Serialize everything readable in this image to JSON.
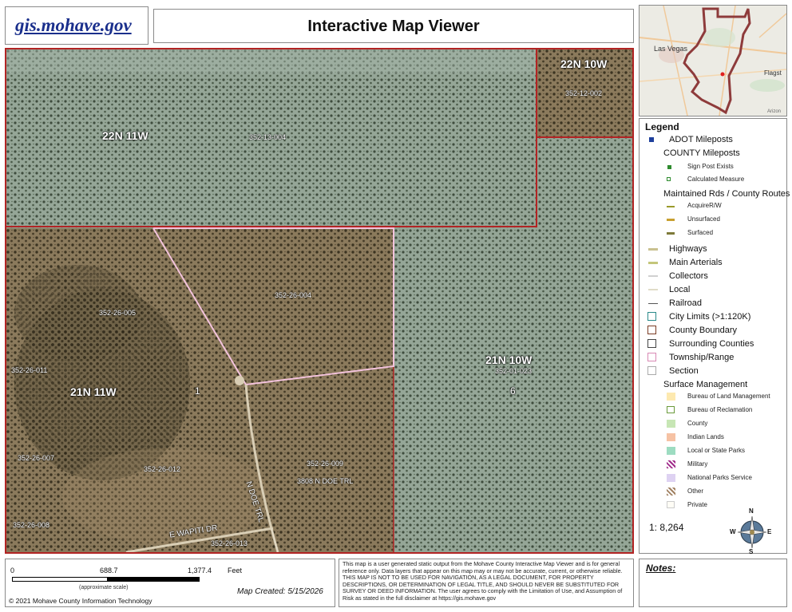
{
  "header": {
    "logo_text": "gis.mohave.gov",
    "title": "Interactive Map Viewer"
  },
  "map": {
    "township_labels": [
      "22N 11W",
      "22N 10W",
      "21N 11W",
      "21N 10W"
    ],
    "section_numbers": [
      "1",
      "6"
    ],
    "parcels": [
      "352-13-004",
      "352-12-002",
      "352-26-005",
      "352-26-004",
      "352-26-011",
      "352-01-023",
      "352-26-007",
      "352-26-012",
      "352-26-009",
      "352-26-008",
      "352-26-013"
    ],
    "address": "3808 N DOE TRL",
    "roads": [
      "E WAPITI DR",
      "N DOE TRL"
    ]
  },
  "inset": {
    "places": [
      "Las Vegas",
      "Flagst",
      "Arizon"
    ]
  },
  "legend": {
    "title": "Legend",
    "items": [
      {
        "label": "ADOT Mileposts",
        "size": "big",
        "symbol": "square-blue"
      },
      {
        "label": "COUNTY Mileposts",
        "size": "head"
      },
      {
        "label": "Sign Post Exists",
        "size": "small",
        "symbol": "square-green"
      },
      {
        "label": "Calculated Measure",
        "size": "small",
        "symbol": "square-green-outline"
      },
      {
        "label": "Maintained Rds / County Routes",
        "size": "head"
      },
      {
        "label": "AcquireR/W",
        "size": "small",
        "symbol": "line-olive"
      },
      {
        "label": "Unsurfaced",
        "size": "small",
        "symbol": "line-gold"
      },
      {
        "label": "Surfaced",
        "size": "small",
        "symbol": "line-darkolive"
      },
      {
        "label": "Highways",
        "size": "big",
        "symbol": "line-tan"
      },
      {
        "label": "Main Arterials",
        "size": "big",
        "symbol": "line-khaki"
      },
      {
        "label": "Collectors",
        "size": "big",
        "symbol": "line-lightgray"
      },
      {
        "label": "Local",
        "size": "big",
        "symbol": "line-pale"
      },
      {
        "label": "Railroad",
        "size": "big",
        "symbol": "railroad"
      },
      {
        "label": "City Limits (>1:120K)",
        "size": "big",
        "symbol": "box-teal"
      },
      {
        "label": "County Boundary",
        "size": "big",
        "symbol": "box-brown"
      },
      {
        "label": "Surrounding Counties",
        "size": "big",
        "symbol": "box-darkgray"
      },
      {
        "label": "Township/Range",
        "size": "big",
        "symbol": "box-pink"
      },
      {
        "label": "Section",
        "size": "big",
        "symbol": "box-lightgray"
      },
      {
        "label": "Surface Management",
        "size": "head"
      },
      {
        "label": "Bureau of Land Management",
        "size": "small",
        "symbol": "fill-blm"
      },
      {
        "label": "Bureau of Reclamation",
        "size": "small",
        "symbol": "fill-bor"
      },
      {
        "label": "County",
        "size": "small",
        "symbol": "fill-county"
      },
      {
        "label": "Indian Lands",
        "size": "small",
        "symbol": "fill-indian"
      },
      {
        "label": "Local or State Parks",
        "size": "small",
        "symbol": "fill-parks"
      },
      {
        "label": "Military",
        "size": "small",
        "symbol": "fill-military"
      },
      {
        "label": "National Parks Service",
        "size": "small",
        "symbol": "fill-nps"
      },
      {
        "label": "Other",
        "size": "small",
        "symbol": "fill-other"
      },
      {
        "label": "Private",
        "size": "small",
        "symbol": "fill-private"
      }
    ]
  },
  "scale_ratio": "1: 8,264",
  "compass": {
    "n": "N",
    "s": "S",
    "e": "E",
    "w": "W"
  },
  "scalebar": {
    "ticks": [
      "0",
      "688.7",
      "1,377.4"
    ],
    "unit": "Feet",
    "note": "(approximate scale)"
  },
  "copyright": "© 2021 Mohave County Information Technology",
  "map_created": "Map Created: 5/15/2026",
  "disclaimer": "This map is a user generated static output from the Mohave County Interactive Map Viewer and is for general reference only. Data layers that appear on this map may or may not be accurate, current, or otherwise reliable. THIS MAP IS NOT TO BE USED FOR NAVIGATION, AS A LEGAL DOCUMENT, FOR PROPERTY DESCRIPTIONS, OR DETERMINATION OF LEGAL TITLE, AND SHOULD NEVER BE SUBSTITUTED FOR SURVEY OR DEED INFORMATION. The user agrees to comply with the Limitation of Use, and Assumption of Risk as stated in the full disclaimer at https://gis.mohave.gov",
  "notes_label": "Notes:"
}
